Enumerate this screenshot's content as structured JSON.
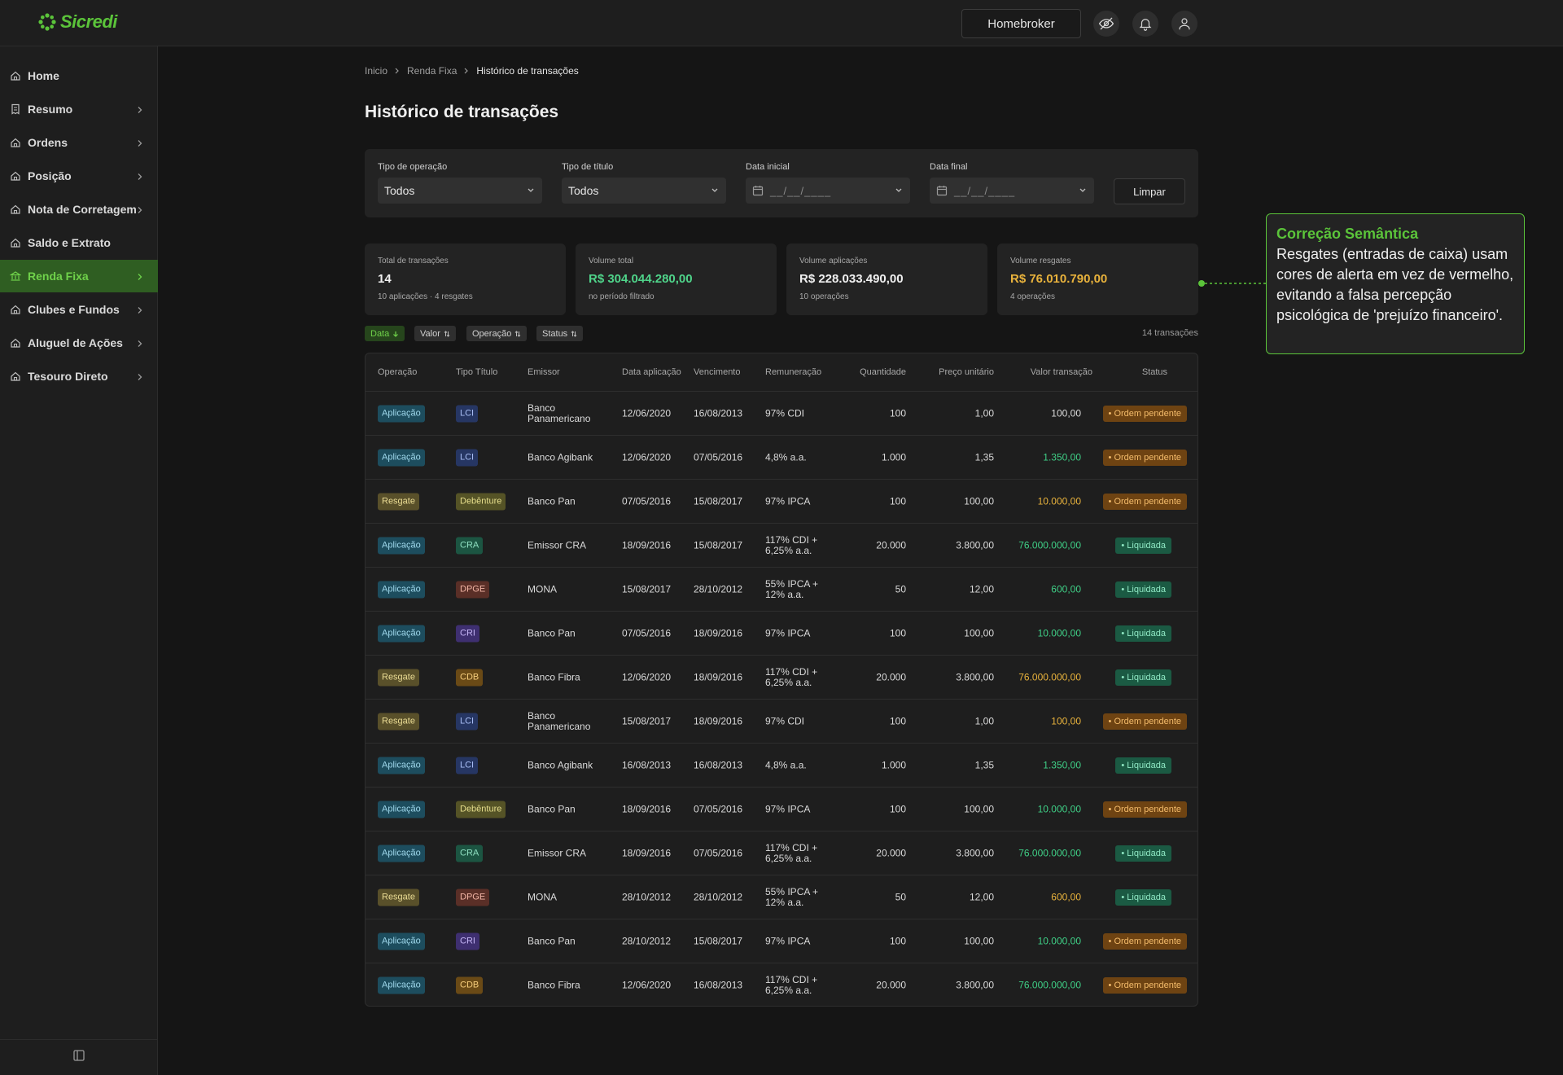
{
  "brand": {
    "name": "Sicredi",
    "color": "#5bc43a"
  },
  "topbar": {
    "homebroker_label": "Homebroker",
    "icons": [
      "eye-off-icon",
      "bell-icon",
      "user-icon"
    ]
  },
  "sidebar": {
    "items": [
      {
        "label": "Home",
        "icon": "home-icon",
        "chevron": false,
        "active": false
      },
      {
        "label": "Resumo",
        "icon": "receipt-icon",
        "chevron": true,
        "active": false
      },
      {
        "label": "Ordens",
        "icon": "home-icon",
        "chevron": true,
        "active": false
      },
      {
        "label": "Posição",
        "icon": "home-icon",
        "chevron": true,
        "active": false
      },
      {
        "label": "Nota de Corretagem",
        "icon": "home-icon",
        "chevron": true,
        "active": false
      },
      {
        "label": "Saldo e Extrato",
        "icon": "home-icon",
        "chevron": false,
        "active": false
      },
      {
        "label": "Renda Fixa",
        "icon": "bank-icon",
        "chevron": true,
        "active": true
      },
      {
        "label": "Clubes e Fundos",
        "icon": "home-icon",
        "chevron": true,
        "active": false
      },
      {
        "label": "Aluguel de Ações",
        "icon": "home-icon",
        "chevron": true,
        "active": false
      },
      {
        "label": "Tesouro Direto",
        "icon": "home-icon",
        "chevron": true,
        "active": false
      }
    ],
    "collapse_icon": "sidebar-collapse-icon"
  },
  "breadcrumb": [
    "Inicio",
    "Renda Fixa",
    "Histórico de transações"
  ],
  "page_title": "Histórico de transações",
  "filters": {
    "operation": {
      "label": "Tipo de operação",
      "value": "Todos"
    },
    "title_type": {
      "label": "Tipo de título",
      "value": "Todos"
    },
    "start_date": {
      "label": "Data inicial",
      "placeholder": "__/__/____"
    },
    "end_date": {
      "label": "Data final",
      "placeholder": "__/__/____"
    },
    "clear_label": "Limpar"
  },
  "stats": [
    {
      "label": "Total de transações",
      "value": "14",
      "sub": "10 aplicações · 4 resgates",
      "color": "#f0f0f0"
    },
    {
      "label": "Volume total",
      "value": "R$ 304.044.280,00",
      "sub": "no período filtrado",
      "color": "#4fd48a"
    },
    {
      "label": "Volume aplicações",
      "value": "R$ 228.033.490,00",
      "sub": "10 operações",
      "color": "#f0f0f0"
    },
    {
      "label": "Volume resgates",
      "value": "R$ 76.010.790,00",
      "sub": "4 operações",
      "color": "#e8b23c"
    }
  ],
  "callout": {
    "title": "Correção Semântica",
    "body": "Resgates (entradas de caixa) usam cores de alerta em vez de vermelho, evitando a falsa percepção psicológica de 'prejuízo financeiro'."
  },
  "sort_chips": [
    {
      "label": "Data",
      "icon": "arrow-down-icon",
      "active": true
    },
    {
      "label": "Valor",
      "icon": "sort-icon",
      "active": false
    },
    {
      "label": "Operação",
      "icon": "sort-icon",
      "active": false
    },
    {
      "label": "Status",
      "icon": "sort-icon",
      "active": false
    }
  ],
  "tx_count": "14 transações",
  "table": {
    "headers": [
      "Operação",
      "Tipo Título",
      "Emissor",
      "Data aplicação",
      "Vencimento",
      "Remuneração",
      "Quantidade",
      "Preço unitário",
      "Valor transação",
      "Status"
    ],
    "colors": {
      "aplicacao_value": "#3fcf86",
      "resgate_value": "#e8b23c"
    },
    "rows": [
      {
        "op": "Aplicação",
        "type": "LCI",
        "issuer": "Banco Panamericano",
        "date": "12/06/2020",
        "due": "16/08/2013",
        "rate": "97% CDI",
        "qty": "100",
        "price": "1,00",
        "value": "100,00",
        "status": "Ordem pendente",
        "value_plain": true
      },
      {
        "op": "Aplicação",
        "type": "LCI",
        "issuer": "Banco Agibank",
        "date": "12/06/2020",
        "due": "07/05/2016",
        "rate": "4,8% a.a.",
        "qty": "1.000",
        "price": "1,35",
        "value": "1.350,00",
        "status": "Ordem pendente"
      },
      {
        "op": "Resgate",
        "type": "Debênture",
        "issuer": "Banco Pan",
        "date": "07/05/2016",
        "due": "15/08/2017",
        "rate": "97% IPCA",
        "qty": "100",
        "price": "100,00",
        "value": "10.000,00",
        "status": "Ordem pendente"
      },
      {
        "op": "Aplicação",
        "type": "CRA",
        "issuer": "Emissor CRA",
        "date": "18/09/2016",
        "due": "15/08/2017",
        "rate": "117% CDI + 6,25% a.a.",
        "qty": "20.000",
        "price": "3.800,00",
        "value": "76.000.000,00",
        "status": "Liquidada"
      },
      {
        "op": "Aplicação",
        "type": "DPGE",
        "issuer": "MONA",
        "date": "15/08/2017",
        "due": "28/10/2012",
        "rate": "55% IPCA + 12% a.a.",
        "qty": "50",
        "price": "12,00",
        "value": "600,00",
        "status": "Liquidada"
      },
      {
        "op": "Aplicação",
        "type": "CRI",
        "issuer": "Banco Pan",
        "date": "07/05/2016",
        "due": "18/09/2016",
        "rate": "97% IPCA",
        "qty": "100",
        "price": "100,00",
        "value": "10.000,00",
        "status": "Liquidada"
      },
      {
        "op": "Resgate",
        "type": "CDB",
        "issuer": "Banco Fibra",
        "date": "12/06/2020",
        "due": "18/09/2016",
        "rate": "117% CDI + 6,25% a.a.",
        "qty": "20.000",
        "price": "3.800,00",
        "value": "76.000.000,00",
        "status": "Liquidada"
      },
      {
        "op": "Resgate",
        "type": "LCI",
        "issuer": "Banco Panamericano",
        "date": "15/08/2017",
        "due": "18/09/2016",
        "rate": "97% CDI",
        "qty": "100",
        "price": "1,00",
        "value": "100,00",
        "status": "Ordem pendente"
      },
      {
        "op": "Aplicação",
        "type": "LCI",
        "issuer": "Banco Agibank",
        "date": "16/08/2013",
        "due": "16/08/2013",
        "rate": "4,8% a.a.",
        "qty": "1.000",
        "price": "1,35",
        "value": "1.350,00",
        "status": "Liquidada"
      },
      {
        "op": "Aplicação",
        "type": "Debênture",
        "issuer": "Banco Pan",
        "date": "18/09/2016",
        "due": "07/05/2016",
        "rate": "97% IPCA",
        "qty": "100",
        "price": "100,00",
        "value": "10.000,00",
        "status": "Ordem pendente"
      },
      {
        "op": "Aplicação",
        "type": "CRA",
        "issuer": "Emissor CRA",
        "date": "18/09/2016",
        "due": "07/05/2016",
        "rate": "117% CDI + 6,25% a.a.",
        "qty": "20.000",
        "price": "3.800,00",
        "value": "76.000.000,00",
        "status": "Liquidada"
      },
      {
        "op": "Resgate",
        "type": "DPGE",
        "issuer": "MONA",
        "date": "28/10/2012",
        "due": "28/10/2012",
        "rate": "55% IPCA + 12% a.a.",
        "qty": "50",
        "price": "12,00",
        "value": "600,00",
        "status": "Liquidada"
      },
      {
        "op": "Aplicação",
        "type": "CRI",
        "issuer": "Banco Pan",
        "date": "28/10/2012",
        "due": "15/08/2017",
        "rate": "97% IPCA",
        "qty": "100",
        "price": "100,00",
        "value": "10.000,00",
        "status": "Ordem pendente"
      },
      {
        "op": "Aplicação",
        "type": "CDB",
        "issuer": "Banco Fibra",
        "date": "12/06/2020",
        "due": "16/08/2013",
        "rate": "117% CDI + 6,25% a.a.",
        "qty": "20.000",
        "price": "3.800,00",
        "value": "76.000.000,00",
        "status": "Ordem pendente"
      }
    ]
  }
}
